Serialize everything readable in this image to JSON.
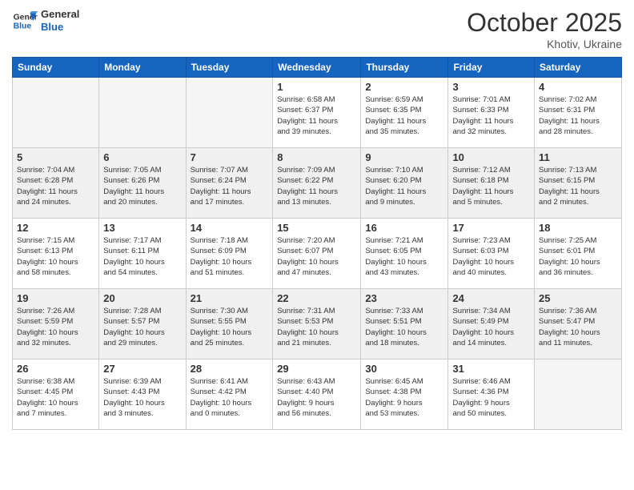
{
  "header": {
    "logo_general": "General",
    "logo_blue": "Blue",
    "month": "October 2025",
    "location": "Khotiv, Ukraine"
  },
  "weekdays": [
    "Sunday",
    "Monday",
    "Tuesday",
    "Wednesday",
    "Thursday",
    "Friday",
    "Saturday"
  ],
  "weeks": [
    [
      {
        "day": "",
        "info": ""
      },
      {
        "day": "",
        "info": ""
      },
      {
        "day": "",
        "info": ""
      },
      {
        "day": "1",
        "info": "Sunrise: 6:58 AM\nSunset: 6:37 PM\nDaylight: 11 hours\nand 39 minutes."
      },
      {
        "day": "2",
        "info": "Sunrise: 6:59 AM\nSunset: 6:35 PM\nDaylight: 11 hours\nand 35 minutes."
      },
      {
        "day": "3",
        "info": "Sunrise: 7:01 AM\nSunset: 6:33 PM\nDaylight: 11 hours\nand 32 minutes."
      },
      {
        "day": "4",
        "info": "Sunrise: 7:02 AM\nSunset: 6:31 PM\nDaylight: 11 hours\nand 28 minutes."
      }
    ],
    [
      {
        "day": "5",
        "info": "Sunrise: 7:04 AM\nSunset: 6:28 PM\nDaylight: 11 hours\nand 24 minutes."
      },
      {
        "day": "6",
        "info": "Sunrise: 7:05 AM\nSunset: 6:26 PM\nDaylight: 11 hours\nand 20 minutes."
      },
      {
        "day": "7",
        "info": "Sunrise: 7:07 AM\nSunset: 6:24 PM\nDaylight: 11 hours\nand 17 minutes."
      },
      {
        "day": "8",
        "info": "Sunrise: 7:09 AM\nSunset: 6:22 PM\nDaylight: 11 hours\nand 13 minutes."
      },
      {
        "day": "9",
        "info": "Sunrise: 7:10 AM\nSunset: 6:20 PM\nDaylight: 11 hours\nand 9 minutes."
      },
      {
        "day": "10",
        "info": "Sunrise: 7:12 AM\nSunset: 6:18 PM\nDaylight: 11 hours\nand 5 minutes."
      },
      {
        "day": "11",
        "info": "Sunrise: 7:13 AM\nSunset: 6:15 PM\nDaylight: 11 hours\nand 2 minutes."
      }
    ],
    [
      {
        "day": "12",
        "info": "Sunrise: 7:15 AM\nSunset: 6:13 PM\nDaylight: 10 hours\nand 58 minutes."
      },
      {
        "day": "13",
        "info": "Sunrise: 7:17 AM\nSunset: 6:11 PM\nDaylight: 10 hours\nand 54 minutes."
      },
      {
        "day": "14",
        "info": "Sunrise: 7:18 AM\nSunset: 6:09 PM\nDaylight: 10 hours\nand 51 minutes."
      },
      {
        "day": "15",
        "info": "Sunrise: 7:20 AM\nSunset: 6:07 PM\nDaylight: 10 hours\nand 47 minutes."
      },
      {
        "day": "16",
        "info": "Sunrise: 7:21 AM\nSunset: 6:05 PM\nDaylight: 10 hours\nand 43 minutes."
      },
      {
        "day": "17",
        "info": "Sunrise: 7:23 AM\nSunset: 6:03 PM\nDaylight: 10 hours\nand 40 minutes."
      },
      {
        "day": "18",
        "info": "Sunrise: 7:25 AM\nSunset: 6:01 PM\nDaylight: 10 hours\nand 36 minutes."
      }
    ],
    [
      {
        "day": "19",
        "info": "Sunrise: 7:26 AM\nSunset: 5:59 PM\nDaylight: 10 hours\nand 32 minutes."
      },
      {
        "day": "20",
        "info": "Sunrise: 7:28 AM\nSunset: 5:57 PM\nDaylight: 10 hours\nand 29 minutes."
      },
      {
        "day": "21",
        "info": "Sunrise: 7:30 AM\nSunset: 5:55 PM\nDaylight: 10 hours\nand 25 minutes."
      },
      {
        "day": "22",
        "info": "Sunrise: 7:31 AM\nSunset: 5:53 PM\nDaylight: 10 hours\nand 21 minutes."
      },
      {
        "day": "23",
        "info": "Sunrise: 7:33 AM\nSunset: 5:51 PM\nDaylight: 10 hours\nand 18 minutes."
      },
      {
        "day": "24",
        "info": "Sunrise: 7:34 AM\nSunset: 5:49 PM\nDaylight: 10 hours\nand 14 minutes."
      },
      {
        "day": "25",
        "info": "Sunrise: 7:36 AM\nSunset: 5:47 PM\nDaylight: 10 hours\nand 11 minutes."
      }
    ],
    [
      {
        "day": "26",
        "info": "Sunrise: 6:38 AM\nSunset: 4:45 PM\nDaylight: 10 hours\nand 7 minutes."
      },
      {
        "day": "27",
        "info": "Sunrise: 6:39 AM\nSunset: 4:43 PM\nDaylight: 10 hours\nand 3 minutes."
      },
      {
        "day": "28",
        "info": "Sunrise: 6:41 AM\nSunset: 4:42 PM\nDaylight: 10 hours\nand 0 minutes."
      },
      {
        "day": "29",
        "info": "Sunrise: 6:43 AM\nSunset: 4:40 PM\nDaylight: 9 hours\nand 56 minutes."
      },
      {
        "day": "30",
        "info": "Sunrise: 6:45 AM\nSunset: 4:38 PM\nDaylight: 9 hours\nand 53 minutes."
      },
      {
        "day": "31",
        "info": "Sunrise: 6:46 AM\nSunset: 4:36 PM\nDaylight: 9 hours\nand 50 minutes."
      },
      {
        "day": "",
        "info": ""
      }
    ]
  ]
}
